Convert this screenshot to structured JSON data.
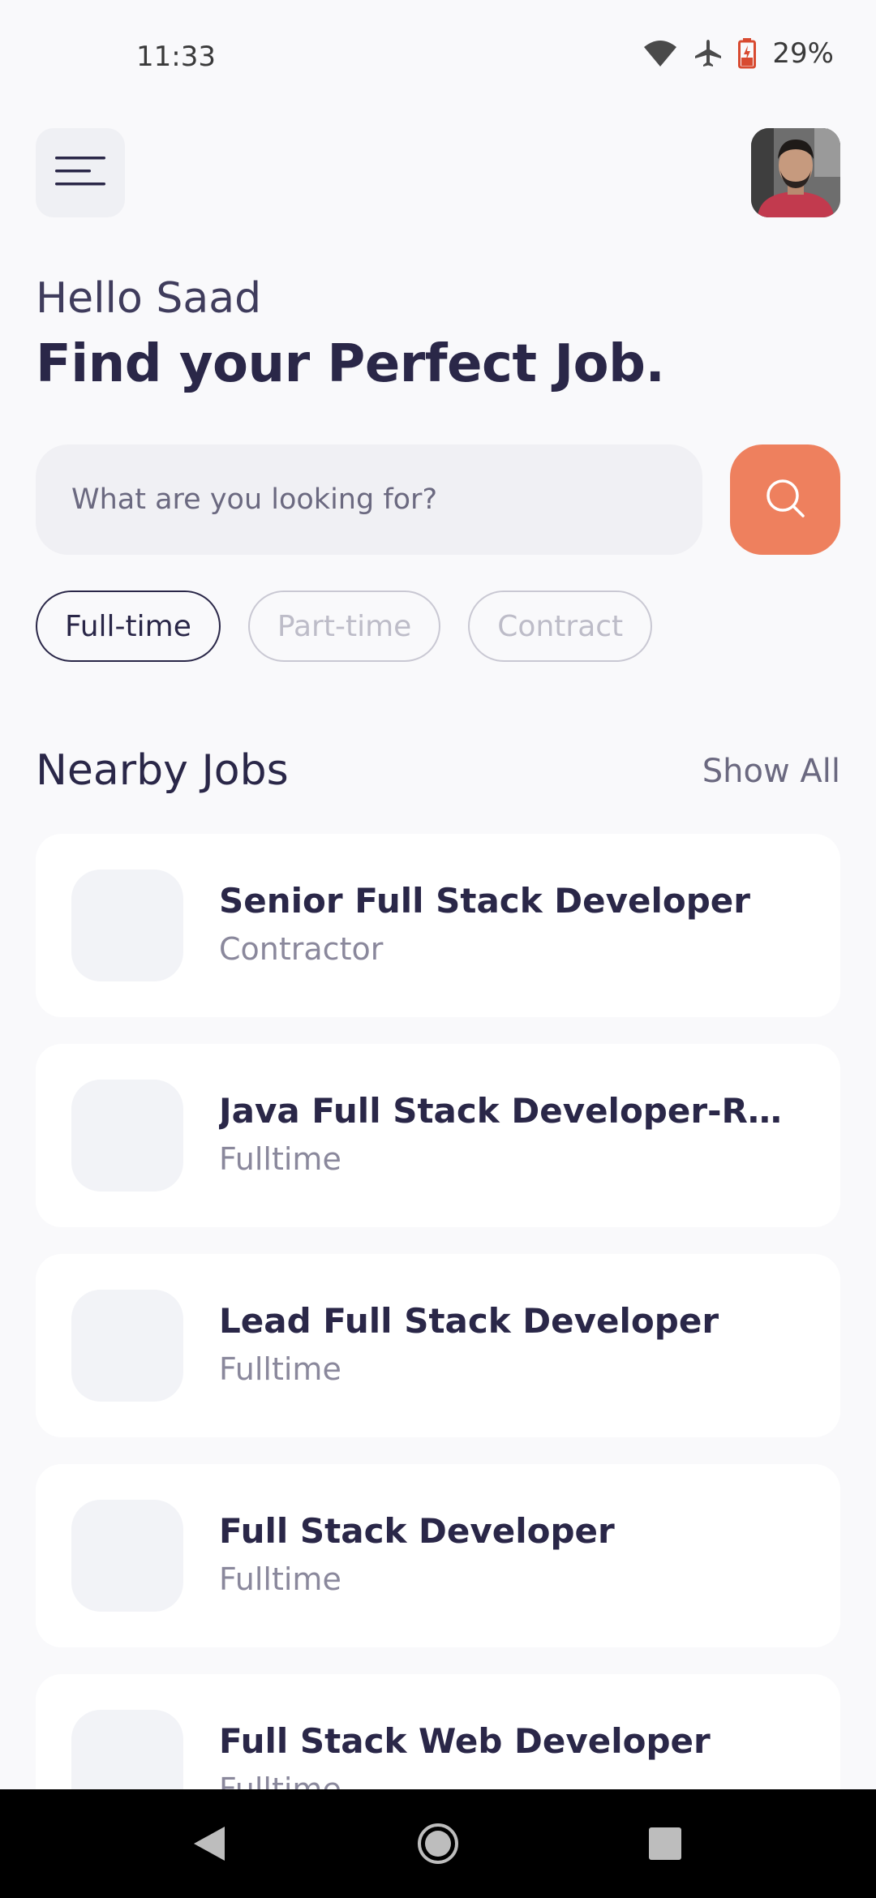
{
  "status_bar": {
    "time": "11:33",
    "battery_percent": "29%",
    "icons": [
      "wifi-icon",
      "airplane-icon",
      "battery-icon"
    ]
  },
  "header": {
    "menu_icon": "hamburger-menu-icon",
    "avatar": "user-avatar"
  },
  "greeting": "Hello Saad",
  "headline": "Find your Perfect Job.",
  "search": {
    "placeholder": "What are you looking for?",
    "value": "",
    "button_icon": "search-icon"
  },
  "filters": [
    {
      "label": "Full-time",
      "selected": true
    },
    {
      "label": "Part-time",
      "selected": false
    },
    {
      "label": "Contract",
      "selected": false
    }
  ],
  "nearby": {
    "title": "Nearby Jobs",
    "show_all": "Show All"
  },
  "jobs": [
    {
      "title": "Senior Full Stack Developer",
      "type": "Contractor"
    },
    {
      "title": "Java Full Stack Developer-Rob…",
      "type": "Fulltime"
    },
    {
      "title": "Lead Full Stack Developer",
      "type": "Fulltime"
    },
    {
      "title": "Full Stack Developer",
      "type": "Fulltime"
    },
    {
      "title": "Full Stack Web Developer",
      "type": "Fulltime"
    }
  ],
  "colors": {
    "accent": "#EE805E",
    "text_primary": "#2A2748",
    "background": "#F9F9FB"
  },
  "nav": [
    "back-icon",
    "home-icon",
    "recents-icon"
  ]
}
